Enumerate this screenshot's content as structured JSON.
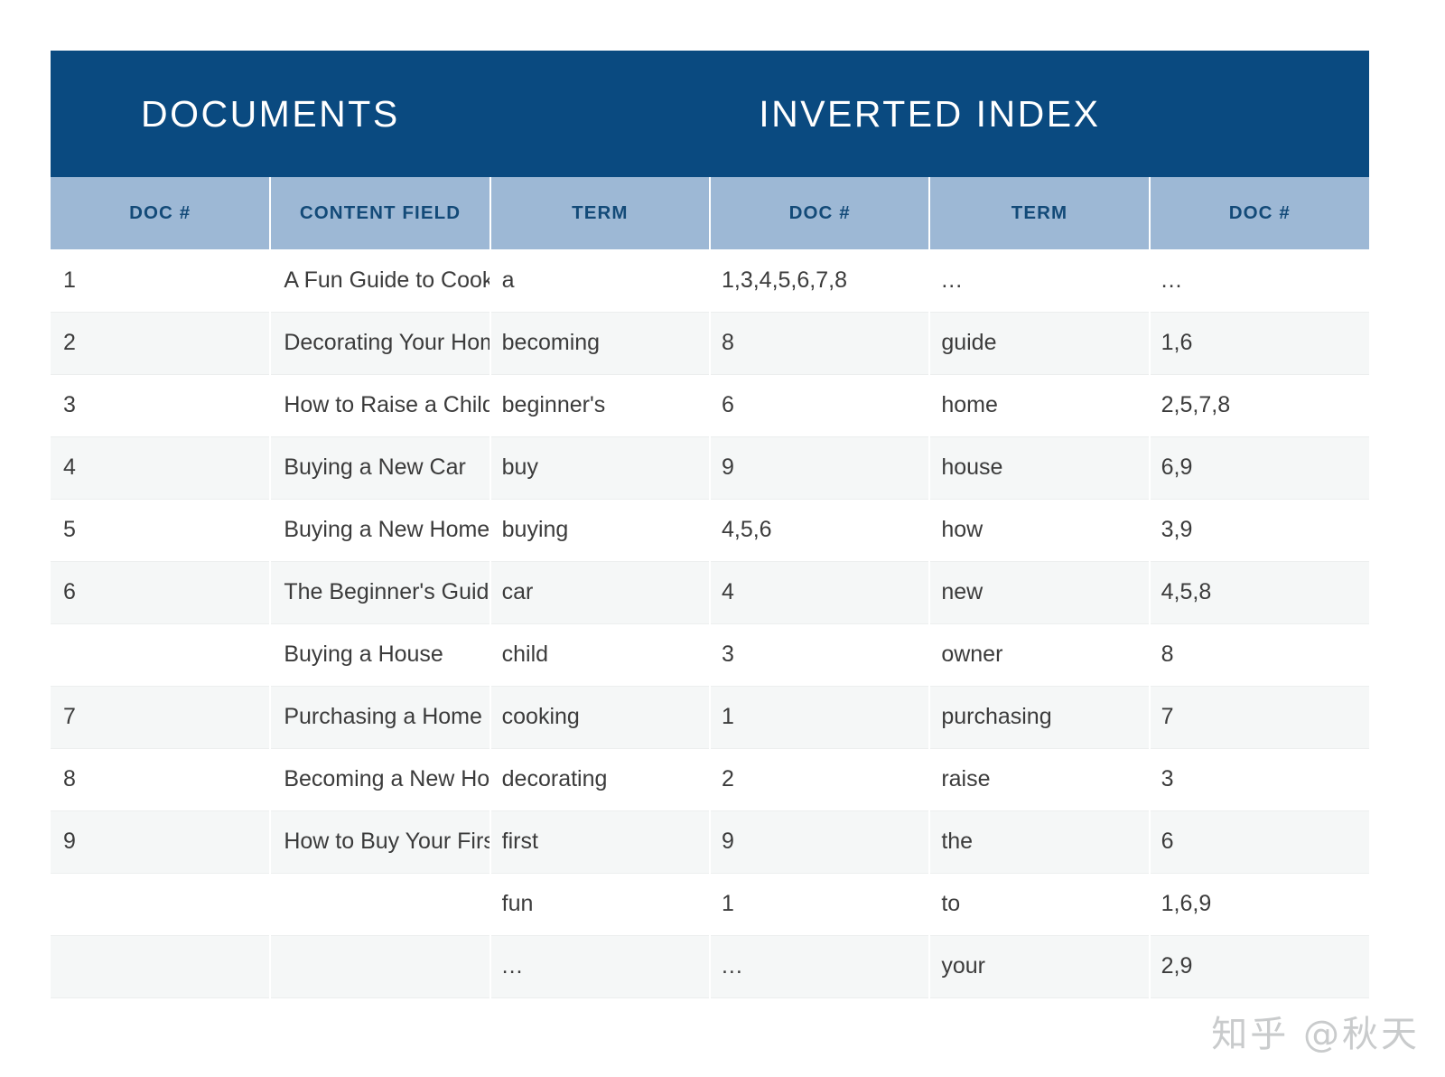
{
  "header": {
    "groups": [
      {
        "label": "DOCUMENTS",
        "span": 2
      },
      {
        "label": "INVERTED INDEX",
        "span": 4
      }
    ],
    "columns": [
      "DOC #",
      "CONTENT FIELD",
      "TERM",
      "DOC #",
      "TERM",
      "DOC #"
    ]
  },
  "rows": [
    {
      "doc_num": "1",
      "content_field": "A Fun Guide to Cooking",
      "term_a": "a",
      "ids_a": "1,3,4,5,6,7,8",
      "term_b": "...",
      "ids_b": "..."
    },
    {
      "doc_num": "2",
      "content_field": "Decorating Your Home",
      "term_a": "becoming",
      "ids_a": "8",
      "term_b": "guide",
      "ids_b": "1,6"
    },
    {
      "doc_num": "3",
      "content_field": "How to Raise a Child",
      "term_a": "beginner's",
      "ids_a": "6",
      "term_b": "home",
      "ids_b": "2,5,7,8"
    },
    {
      "doc_num": "4",
      "content_field": "Buying a New Car",
      "term_a": "buy",
      "ids_a": "9",
      "term_b": "house",
      "ids_b": "6,9"
    },
    {
      "doc_num": "5",
      "content_field": "Buying a New Home",
      "term_a": "buying",
      "ids_a": "4,5,6",
      "term_b": "how",
      "ids_b": "3,9"
    },
    {
      "doc_num": "6",
      "content_field": "The Beginner's Guide to",
      "term_a": "car",
      "ids_a": "4",
      "term_b": "new",
      "ids_b": "4,5,8"
    },
    {
      "doc_num": "",
      "content_field": "Buying a House",
      "term_a": "child",
      "ids_a": "3",
      "term_b": "owner",
      "ids_b": "8"
    },
    {
      "doc_num": "7",
      "content_field": "Purchasing a Home",
      "term_a": "cooking",
      "ids_a": "1",
      "term_b": "purchasing",
      "ids_b": "7"
    },
    {
      "doc_num": "8",
      "content_field": "Becoming a New Home Owner",
      "term_a": "decorating",
      "ids_a": "2",
      "term_b": "raise",
      "ids_b": "3"
    },
    {
      "doc_num": "9",
      "content_field": "How to Buy Your First House",
      "term_a": "first",
      "ids_a": "9",
      "term_b": "the",
      "ids_b": "6"
    },
    {
      "doc_num": "",
      "content_field": "",
      "term_a": "fun",
      "ids_a": "1",
      "term_b": "to",
      "ids_b": "1,6,9"
    },
    {
      "doc_num": "",
      "content_field": "",
      "term_a": "...",
      "ids_a": "...",
      "term_b": "your",
      "ids_b": "2,9"
    }
  ],
  "watermark": {
    "text": "知乎 @秋天"
  },
  "colors": {
    "group_header_bg": "#0a4a80",
    "column_header_bg": "#9db8d5",
    "column_header_text": "#134a78",
    "row_alt_bg": "#f5f7f7",
    "row_bg": "#ffffff",
    "body_text": "#3b3b3b",
    "watermark": "#c9cbcc"
  }
}
